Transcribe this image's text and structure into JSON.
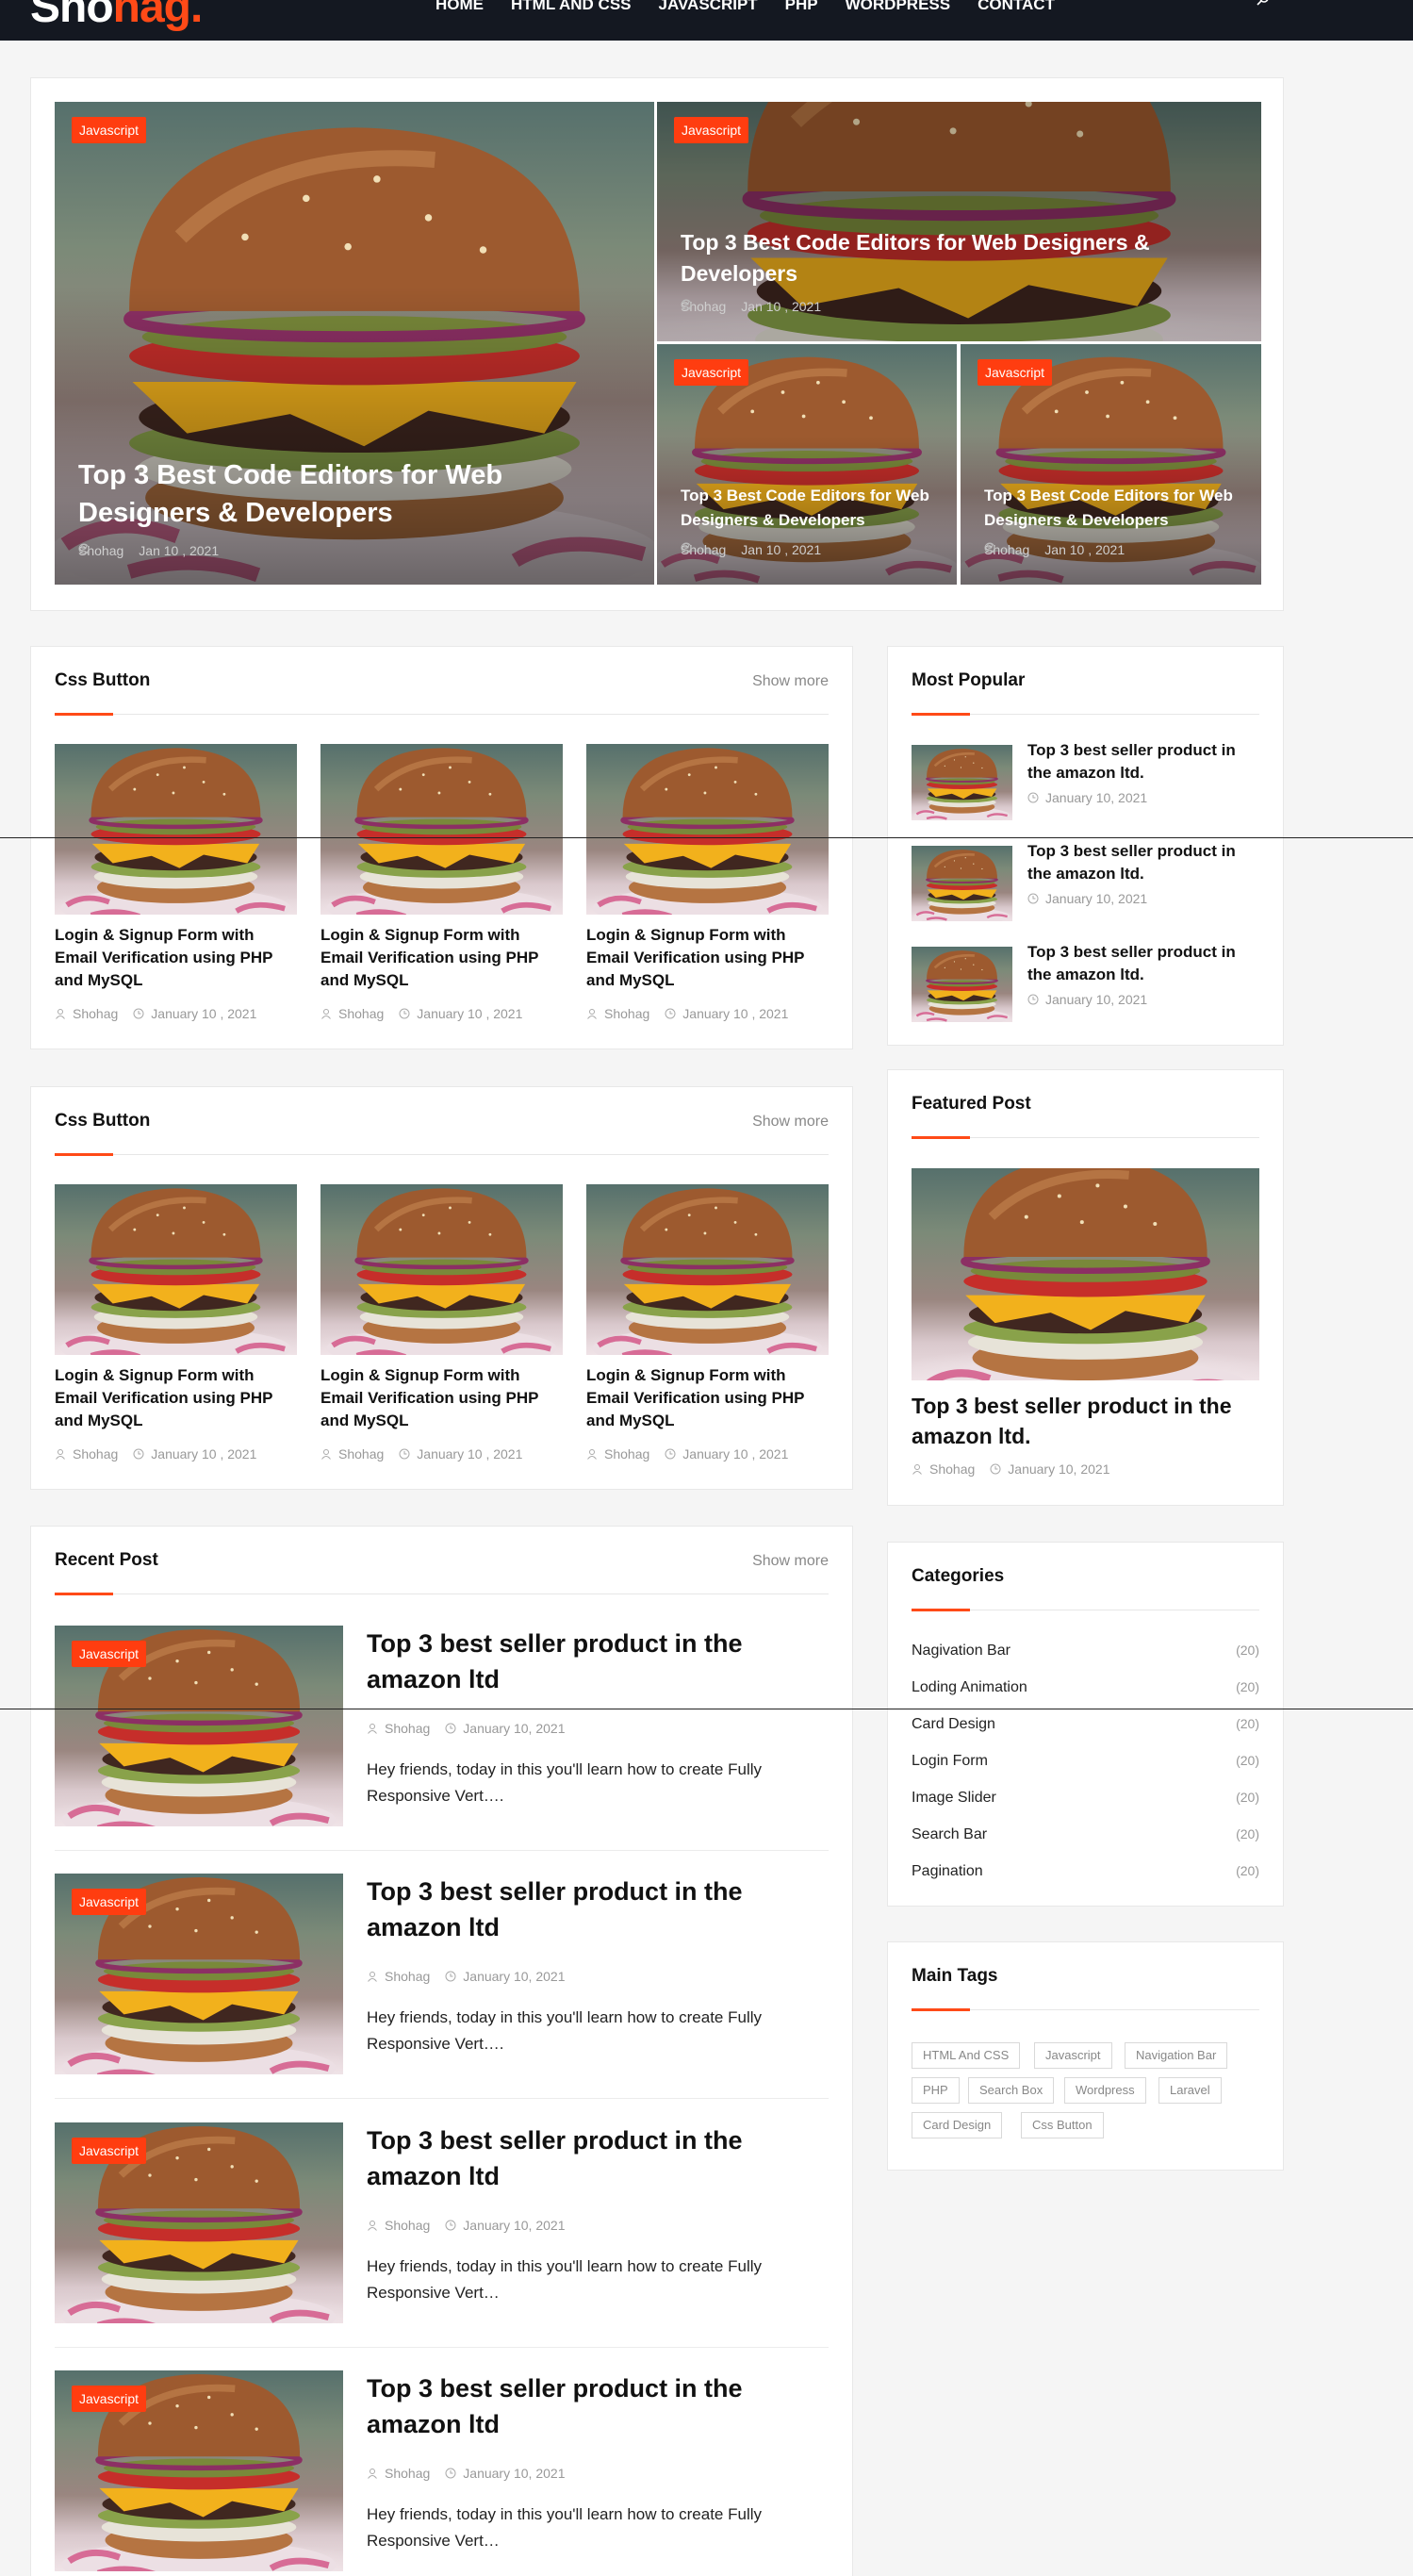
{
  "header": {
    "logo_main": "Sho",
    "logo_accent": "hag.",
    "nav": [
      "HOME",
      "HTML AND CSS",
      "JAVASCRIPT",
      "PHP",
      "WORDPRESS",
      "CONTACT"
    ]
  },
  "hero": {
    "items": [
      {
        "badge": "Javascript",
        "title": "Top 3 Best Code Editors for Web Designers & Developers",
        "author": "Shohag",
        "date": "Jan 10 , 2021"
      },
      {
        "badge": "Javascript",
        "title": "Top 3 Best Code Editors for Web Designers & Developers",
        "author": "Shohag",
        "date": "Jan 10 , 2021"
      },
      {
        "badge": "Javascript",
        "title": "Top 3 Best Code Editors for Web Designers & Developers",
        "author": "Shohag",
        "date": "Jan 10 , 2021"
      },
      {
        "badge": "Javascript",
        "title": "Top 3 Best Code Editors for Web Designers & Developers",
        "author": "Shohag",
        "date": "Jan 10 , 2021"
      }
    ]
  },
  "css_button_1": {
    "title": "Css Button",
    "show_more": "Show more",
    "posts": [
      {
        "title": "Login & Signup Form with Email Verification using PHP and MySQL",
        "author": "Shohag",
        "date": "January 10 , 2021"
      },
      {
        "title": "Login & Signup Form with Email Verification using PHP and MySQL",
        "author": "Shohag",
        "date": "January 10 , 2021"
      },
      {
        "title": "Login & Signup Form with Email Verification using PHP and MySQL",
        "author": "Shohag",
        "date": "January 10 , 2021"
      }
    ]
  },
  "css_button_2": {
    "title": "Css Button",
    "show_more": "Show more",
    "posts": [
      {
        "title": "Login & Signup Form with Email Verification using PHP and MySQL",
        "author": "Shohag",
        "date": "January 10 , 2021"
      },
      {
        "title": "Login & Signup Form with Email Verification using PHP and MySQL",
        "author": "Shohag",
        "date": "January 10 , 2021"
      },
      {
        "title": "Login & Signup Form with Email Verification using PHP and MySQL",
        "author": "Shohag",
        "date": "January 10 , 2021"
      }
    ]
  },
  "recent": {
    "title": "Recent Post",
    "show_more": "Show more",
    "posts": [
      {
        "badge": "Javascript",
        "title": "Top 3 best seller product in the amazon ltd",
        "author": "Shohag",
        "date": "January 10, 2021",
        "excerpt": "Hey friends, today in this you'll learn how to create Fully Responsive Vert…."
      },
      {
        "badge": "Javascript",
        "title": "Top 3 best seller product in the amazon ltd",
        "author": "Shohag",
        "date": "January 10, 2021",
        "excerpt": "Hey friends, today in this you'll learn how to create Fully Responsive Vert…."
      },
      {
        "badge": "Javascript",
        "title": "Top 3 best seller product in the amazon ltd",
        "author": "Shohag",
        "date": "January 10, 2021",
        "excerpt": "Hey friends, today in this you'll learn how to create Fully Responsive Vert…"
      },
      {
        "badge": "Javascript",
        "title": "Top 3 best seller product in the amazon ltd",
        "author": "Shohag",
        "date": "January 10, 2021",
        "excerpt": "Hey friends, today in this you'll learn how to create Fully Responsive Vert…"
      }
    ]
  },
  "most_popular": {
    "title": "Most Popular",
    "posts": [
      {
        "title": "Top 3 best seller product in the amazon ltd.",
        "date": "January 10, 2021"
      },
      {
        "title": "Top 3 best seller product in the amazon ltd.",
        "date": "January 10, 2021"
      },
      {
        "title": "Top 3 best seller product in the amazon ltd.",
        "date": "January 10, 2021"
      }
    ]
  },
  "featured": {
    "title": "Featured Post",
    "post_title": "Top 3 best seller product in the amazon ltd.",
    "author": "Shohag",
    "date": "January 10, 2021"
  },
  "categories": {
    "title": "Categories",
    "items": [
      {
        "label": "Nagivation Bar",
        "count": "(20)"
      },
      {
        "label": "Loding Animation",
        "count": "(20)"
      },
      {
        "label": "Card Design",
        "count": "(20)"
      },
      {
        "label": "Login Form",
        "count": "(20)"
      },
      {
        "label": "Image Slider",
        "count": "(20)"
      },
      {
        "label": "Search Bar",
        "count": "(20)"
      },
      {
        "label": "Pagination",
        "count": "(20)"
      }
    ]
  },
  "tags": {
    "title": "Main Tags",
    "items": [
      "HTML And CSS",
      "Javascript",
      "Navigation Bar",
      "PHP",
      "Search Box",
      "Wordpress",
      "Laravel",
      "Card Design",
      "Css Button"
    ]
  },
  "colors": {
    "accent": "#ff4a17",
    "header_bg": "#141821",
    "badge": "#ff3d10"
  }
}
